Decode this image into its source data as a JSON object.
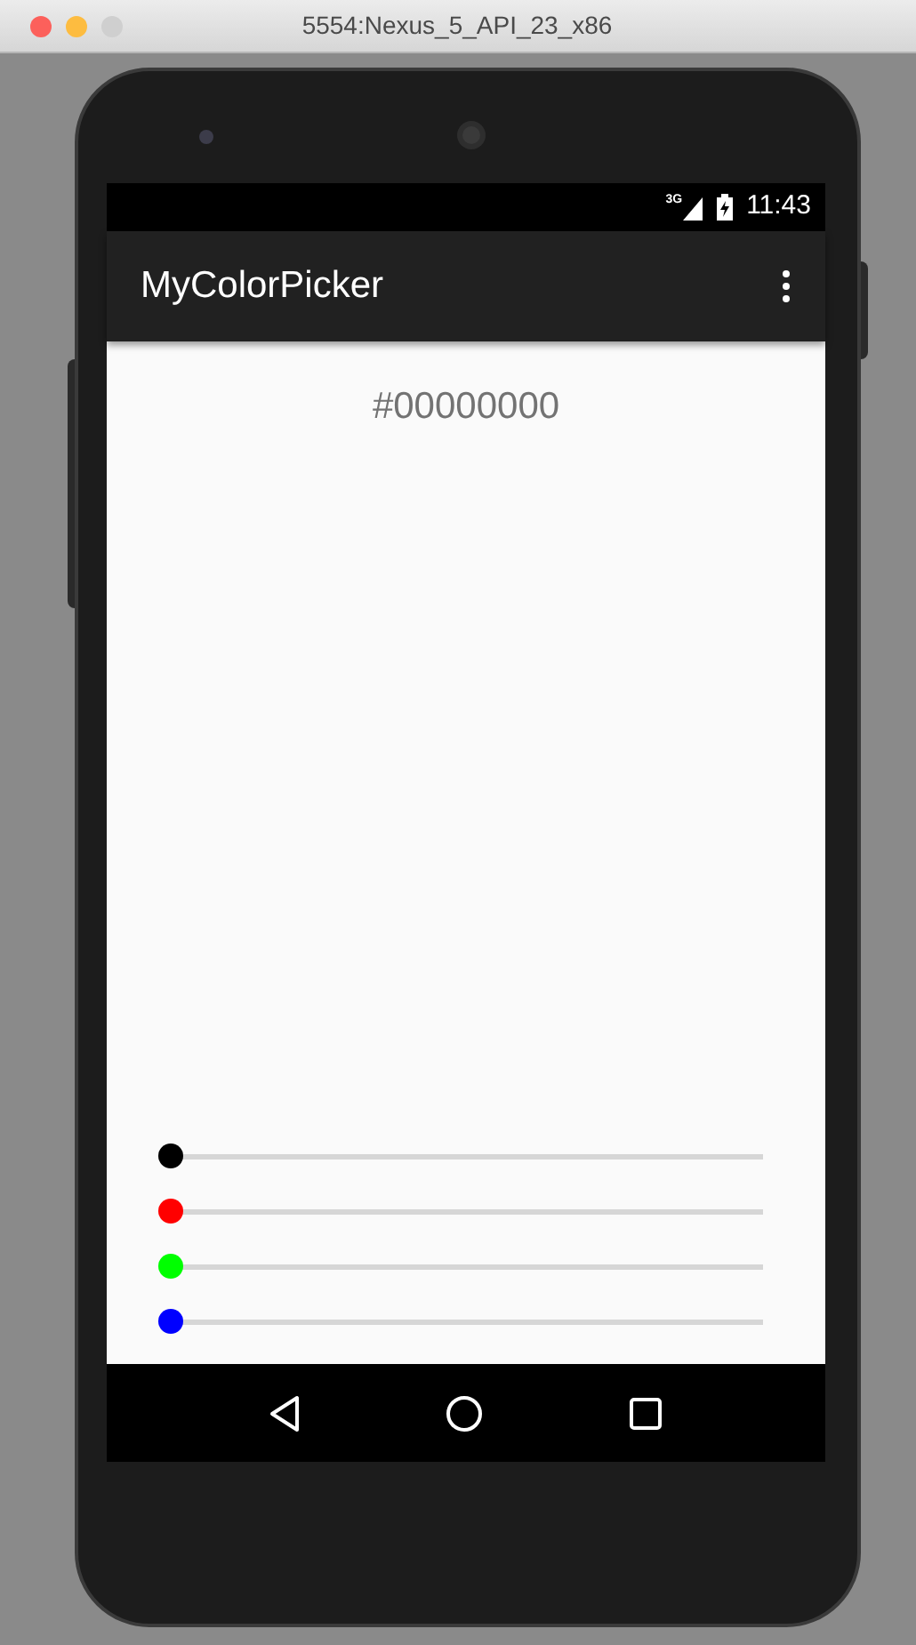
{
  "window": {
    "title": "5554:Nexus_5_API_23_x86"
  },
  "status_bar": {
    "network": "3G",
    "time": "11:43"
  },
  "app_bar": {
    "title": "MyColorPicker"
  },
  "color_value": "#00000000",
  "sliders": [
    {
      "color": "#000000",
      "level": 0
    },
    {
      "color": "#ff0000",
      "level": 0
    },
    {
      "color": "#00ff00",
      "level": 0
    },
    {
      "color": "#0000ff",
      "level": 0
    }
  ]
}
